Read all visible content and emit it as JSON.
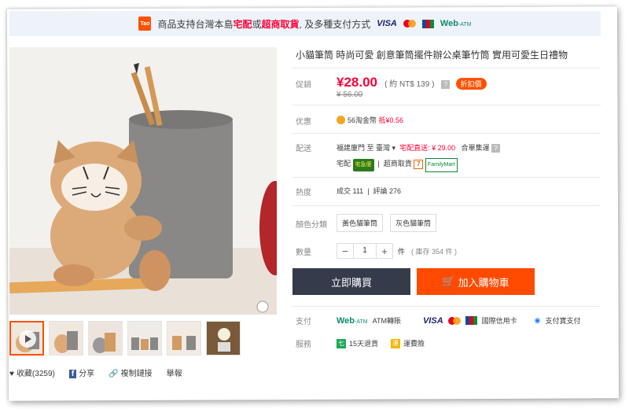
{
  "banner": {
    "logo": "Tao",
    "text_before": "商品支持台灣本島",
    "hl1": "宅配",
    "or": "或",
    "hl2": "超商取貨",
    "text_after": ", 及多種支付方式",
    "visa": "VISA",
    "webatm": "Web",
    "webatm_small": "-ATM"
  },
  "product": {
    "title": "小貓筆筒 時尚可愛 創意筆筒擺件辦公桌筆竹筒 實用可愛生日禮物",
    "price_label": "促銷",
    "price": "¥28.00",
    "price_ntd": "( 約 NT$ 139 )",
    "discount_badge": "折扣價",
    "original_price": "¥ 56.00",
    "promo_label": "优惠",
    "promo_text": "56淘金幣",
    "promo_deduct": "抵¥0.56",
    "shipping_label": "配送",
    "shipping_from": "福建廈門 至 臺灣",
    "shipping_cost": "宅配直送: ¥ 29.00",
    "shipping_mode": "合單集運",
    "carrier_home": "宅配",
    "carrier_pickup": "超商取貨",
    "sales_label": "熱度",
    "sales": "成交 111",
    "reviews": "評論 276",
    "color_label": "顏色分類",
    "colors": [
      "黃色貓筆筒",
      "灰色貓筆筒"
    ],
    "qty_label": "數量",
    "qty_value": "1",
    "qty_unit": "件",
    "stock": "( 庫存 354 件 )",
    "buy_now": "立即購買",
    "add_cart": "加入購物車",
    "pay_label": "支付",
    "pay_atm": "ATM轉賬",
    "pay_card": "國際信用卡",
    "pay_alipay": "支付寶支付",
    "service_label": "服務",
    "service_return": "15天退貨",
    "service_ship": "運費險"
  },
  "social": {
    "favorite": "收藏(3259)",
    "share": "分享",
    "copy_link": "複制鏈接",
    "report": "舉報"
  },
  "colors": {
    "accent": "#ff5000",
    "price": "#ff0036",
    "buy_btn": "#353b4b",
    "cart_btn": "#ff4a00"
  }
}
